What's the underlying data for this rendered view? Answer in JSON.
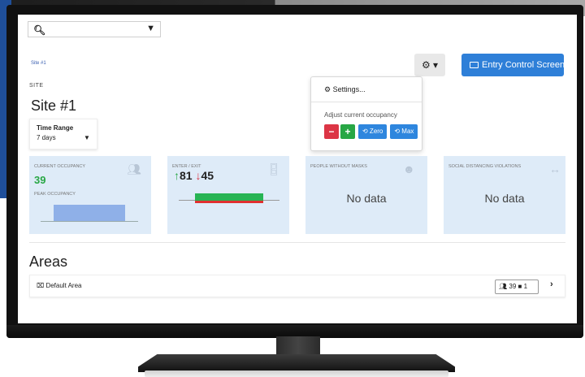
{
  "search": {
    "icon": "search-icon",
    "placeholder": ""
  },
  "breadcrumb": {
    "site": "Site #1"
  },
  "toolbar": {
    "gear_label": "⚙ ▾",
    "entry_label": "Entry Control Screen"
  },
  "dropdown": {
    "settings_label": "Settings...",
    "adjust_label": "Adjust current occupancy",
    "minus_label": "−",
    "plus_label": "+",
    "zero_label": "⟲ Zero",
    "max_label": "⟲ Max"
  },
  "site": {
    "section_label": "SITE",
    "title": "Site #1",
    "time_range_label": "Time Range",
    "time_range_value": "7 days"
  },
  "cards": {
    "occupancy": {
      "label": "CURRENT OCCUPANCY",
      "value": "39",
      "peak_label": "PEAK OCCUPANCY"
    },
    "enter_exit": {
      "label": "ENTER / EXIT",
      "enter": "81",
      "exit": "45"
    },
    "masks": {
      "label": "PEOPLE WITHOUT MASKS",
      "value": "No data"
    },
    "distancing": {
      "label": "SOCIAL DISTANCING VIOLATIONS",
      "value": "No data"
    }
  },
  "areas": {
    "title": "Areas",
    "rows": [
      {
        "name": "Default Area",
        "people": "39",
        "cameras": "1"
      }
    ]
  },
  "colors": {
    "accent": "#2e7fd8",
    "card_bg": "#deebf8",
    "green": "#28a745",
    "red": "#dc3545"
  }
}
